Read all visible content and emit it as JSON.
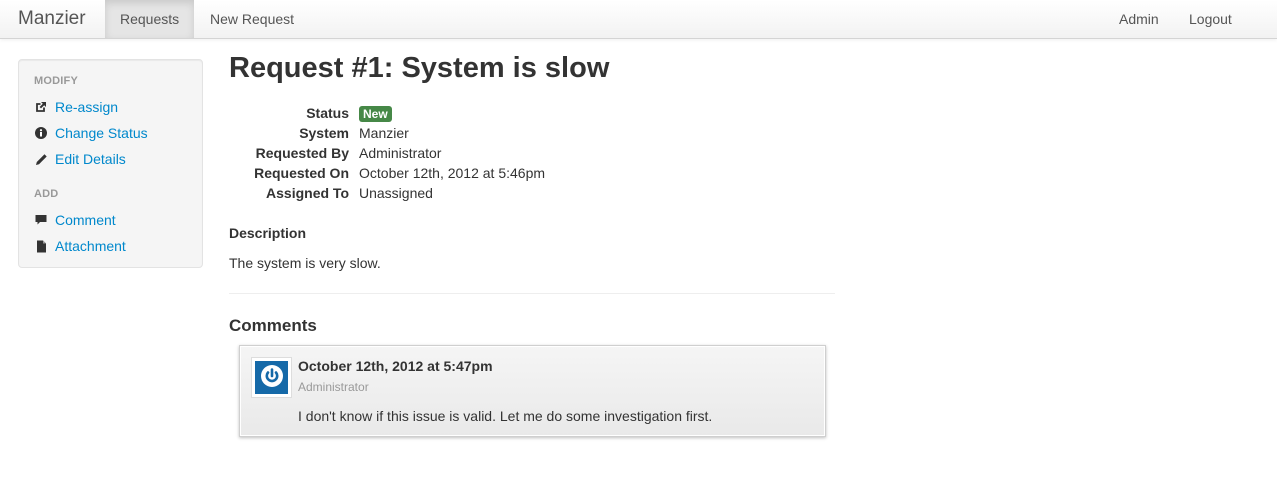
{
  "navbar": {
    "brand": "Manzier",
    "left_items": [
      {
        "label": "Requests",
        "active": true
      },
      {
        "label": "New Request",
        "active": false
      }
    ],
    "right_items": [
      {
        "label": "Admin"
      },
      {
        "label": "Logout"
      }
    ]
  },
  "sidebar": {
    "sections": [
      {
        "header": "MODIFY",
        "items": [
          {
            "label": "Re-assign",
            "icon": "share-icon"
          },
          {
            "label": "Change Status",
            "icon": "info-sign-icon"
          },
          {
            "label": "Edit Details",
            "icon": "pencil-icon"
          }
        ]
      },
      {
        "header": "ADD",
        "items": [
          {
            "label": "Comment",
            "icon": "comment-icon"
          },
          {
            "label": "Attachment",
            "icon": "file-icon"
          }
        ]
      }
    ]
  },
  "request": {
    "title": "Request #1: System is slow",
    "details": [
      {
        "term": "Status",
        "value": "New",
        "badge": true
      },
      {
        "term": "System",
        "value": "Manzier"
      },
      {
        "term": "Requested By",
        "value": "Administrator"
      },
      {
        "term": "Requested On",
        "value": "October 12th, 2012 at 5:46pm"
      },
      {
        "term": "Assigned To",
        "value": "Unassigned"
      }
    ],
    "description_label": "Description",
    "description": "The system is very slow."
  },
  "comments": {
    "heading": "Comments",
    "items": [
      {
        "timestamp": "October 12th, 2012 at 5:47pm",
        "author": "Administrator",
        "text": "I don't know if this issue is valid. Let me do some investigation first.",
        "avatar_icon": "power-icon"
      }
    ]
  },
  "colors": {
    "link": "#0088cc",
    "badge_success": "#468847",
    "avatar_bg": "#1569a8"
  }
}
